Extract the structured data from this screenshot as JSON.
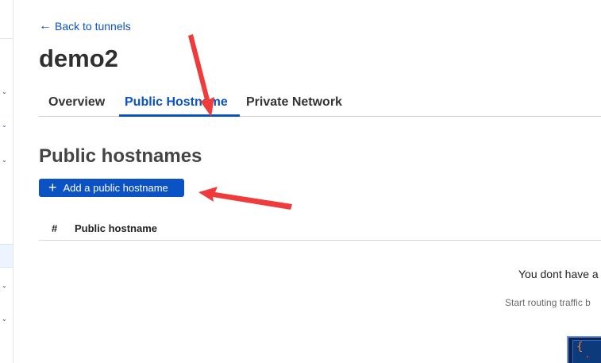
{
  "navigation": {
    "back_arrow": "←",
    "back_label": "Back to tunnels"
  },
  "page": {
    "title": "demo2"
  },
  "tabs": [
    {
      "label": "Overview",
      "active": false
    },
    {
      "label": "Public Hostname",
      "active": true
    },
    {
      "label": "Private Network",
      "active": false
    }
  ],
  "section": {
    "heading": "Public hostnames",
    "add_button_icon": "+",
    "add_button_label": "Add a public hostname"
  },
  "table": {
    "columns": [
      {
        "label": "#"
      },
      {
        "label": "Public hostname"
      }
    ]
  },
  "empty_state": {
    "title": "You dont have a",
    "subtitle": "Start routing traffic b",
    "code_symbol": "{"
  },
  "icons": {
    "back": "arrow-left-icon",
    "add": "plus-icon",
    "rail_chevron": "chevron-down-icon",
    "annotation": "red-arrow-annotation"
  },
  "colors": {
    "brand_blue": "#0b52c4",
    "annotation_red": "#ef3b3b",
    "title_text": "#2f2f2f",
    "muted_text": "#6b6b6b"
  }
}
